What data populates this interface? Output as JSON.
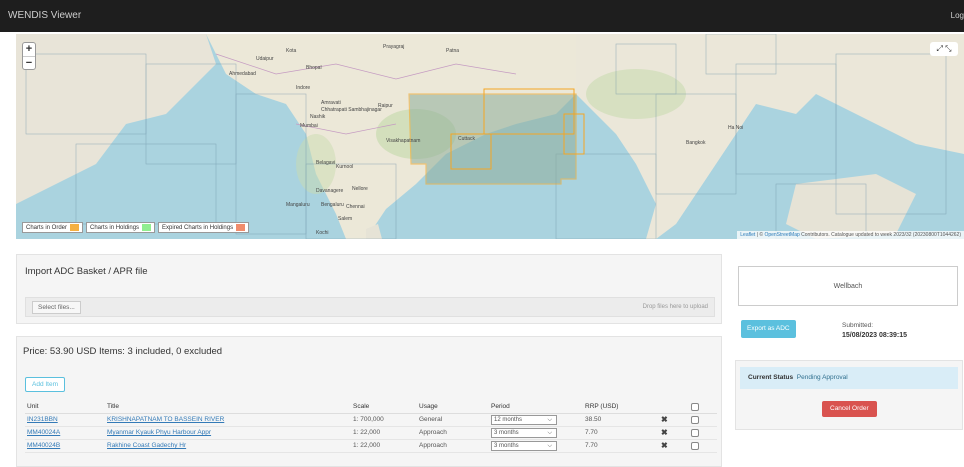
{
  "app": {
    "title": "WENDIS Viewer",
    "login_label": "Log"
  },
  "map": {
    "zoom_in": "+",
    "zoom_out": "−",
    "fullscreen": "⤢ ⤡",
    "legend": [
      {
        "label": "Charts in Order",
        "color": "#f5b041"
      },
      {
        "label": "Charts in Holdings",
        "color": "#90ee90"
      },
      {
        "label": "Expired Charts in Holdings",
        "color": "#f08c6c"
      }
    ],
    "attribution_link1": "Leaflet",
    "attribution_sep": " | © ",
    "attribution_link2": "OpenStreetMap",
    "attribution_rest": " Contributors. Catalogue updated to week 2023/32 (20230800T1044262)",
    "place_labels": [
      "Kota",
      "Prayagraj",
      "Patna",
      "Udaipur",
      "Bhopal",
      "Ahmedabad",
      "Indore",
      "Amravati",
      "Nashik",
      "Chhatrapati Sambhajinagar",
      "Mumbai",
      "Raipur",
      "Cuttack",
      "Visakhapatnam",
      "Belagavi",
      "Kurnool",
      "Nellore",
      "Davanagere",
      "Bengaluru",
      "Chennai",
      "Mangaluru",
      "Salem",
      "Kochi",
      "Bangkok",
      "Ha Noi"
    ]
  },
  "import": {
    "title": "Import ADC Basket / APR file",
    "select_label": "Select files...",
    "drop_hint": "Drop files here to upload"
  },
  "order": {
    "summary": "Price: 53.90 USD Items: 3 included, 0 excluded",
    "add_item": "Add Item",
    "columns": [
      "Unit",
      "Title",
      "Scale",
      "Usage",
      "Period",
      "RRP (USD)"
    ],
    "rows": [
      {
        "unit": "IN231BBN",
        "title": "KRISHNAPATNAM TO BASSEIN RIVER",
        "scale": "1: 700,000",
        "usage": "General",
        "period": "12 months",
        "rrp": "38.50"
      },
      {
        "unit": "MM40024A",
        "title": "Myanmar Kyauk Phyu Harbour Appr",
        "scale": "1: 22,000",
        "usage": "Approach",
        "period": "3 months",
        "rrp": "7.70"
      },
      {
        "unit": "MM40024B",
        "title": "Rakhine Coast Gadechy Hr",
        "scale": "1: 22,000",
        "usage": "Approach",
        "period": "3 months",
        "rrp": "7.70"
      }
    ],
    "remove_icon": "✖"
  },
  "side": {
    "customer": "Wellbach",
    "export_label": "Export as ADC",
    "submitted_label": "Submitted:",
    "submitted_date": "15/08/2023 08:39:15",
    "status_label": "Current Status",
    "status_value": "Pending Approval",
    "cancel_label": "Cancel Order"
  }
}
